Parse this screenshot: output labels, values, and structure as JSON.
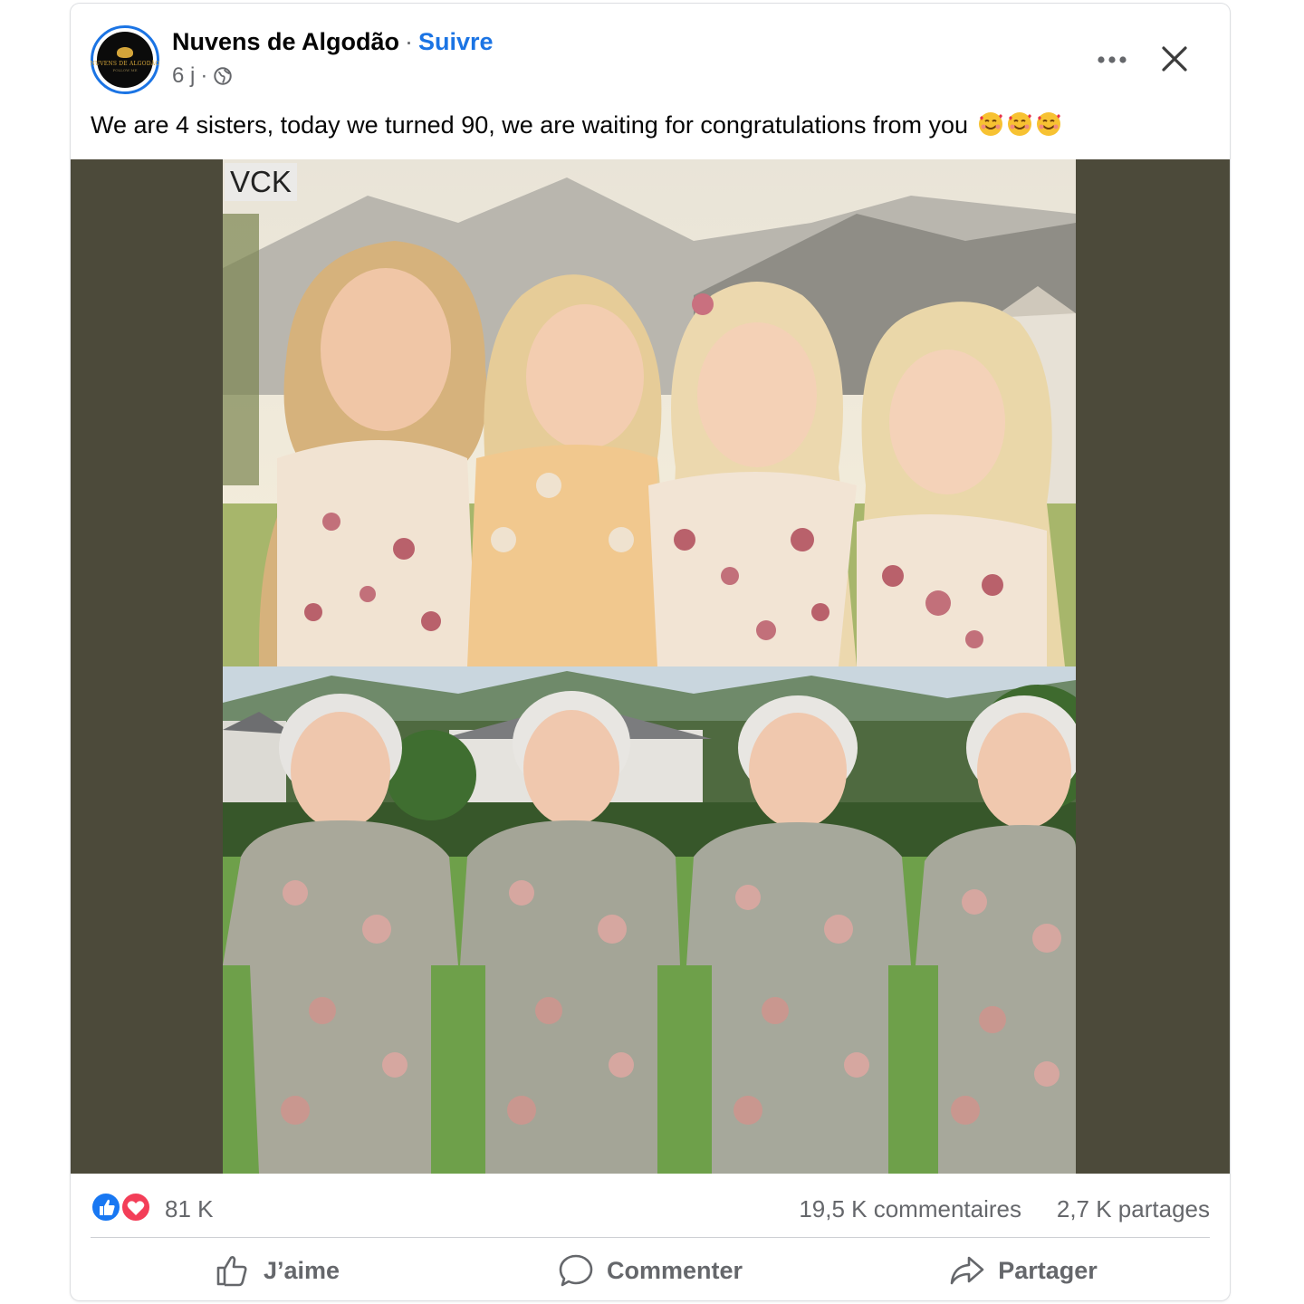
{
  "post": {
    "page_name": "Nuvens de Algodão",
    "separator": "·",
    "follow_label": "Suivre",
    "time": "6 j",
    "time_sep": "·",
    "avatar_text": "NUVENS DE ALGODÃO",
    "avatar_subtext": "FOLLOW ME",
    "text": "We are 4 sisters, today we turned 90, we are waiting for congratulations from you",
    "emojis": [
      "smiling-face-with-hearts",
      "smiling-face-with-hearts",
      "smiling-face-with-hearts"
    ]
  },
  "media": {
    "watermark": "VCK"
  },
  "stats": {
    "reactions": [
      "like",
      "love"
    ],
    "reaction_count": "81 K",
    "comments": "19,5 K commentaires",
    "shares": "2,7 K partages"
  },
  "actions": {
    "like": "J’aime",
    "comment": "Commenter",
    "share": "Partager"
  },
  "colors": {
    "accent": "#1b74e4",
    "secondary_text": "#65676b",
    "media_background": "#4c4a3a"
  }
}
